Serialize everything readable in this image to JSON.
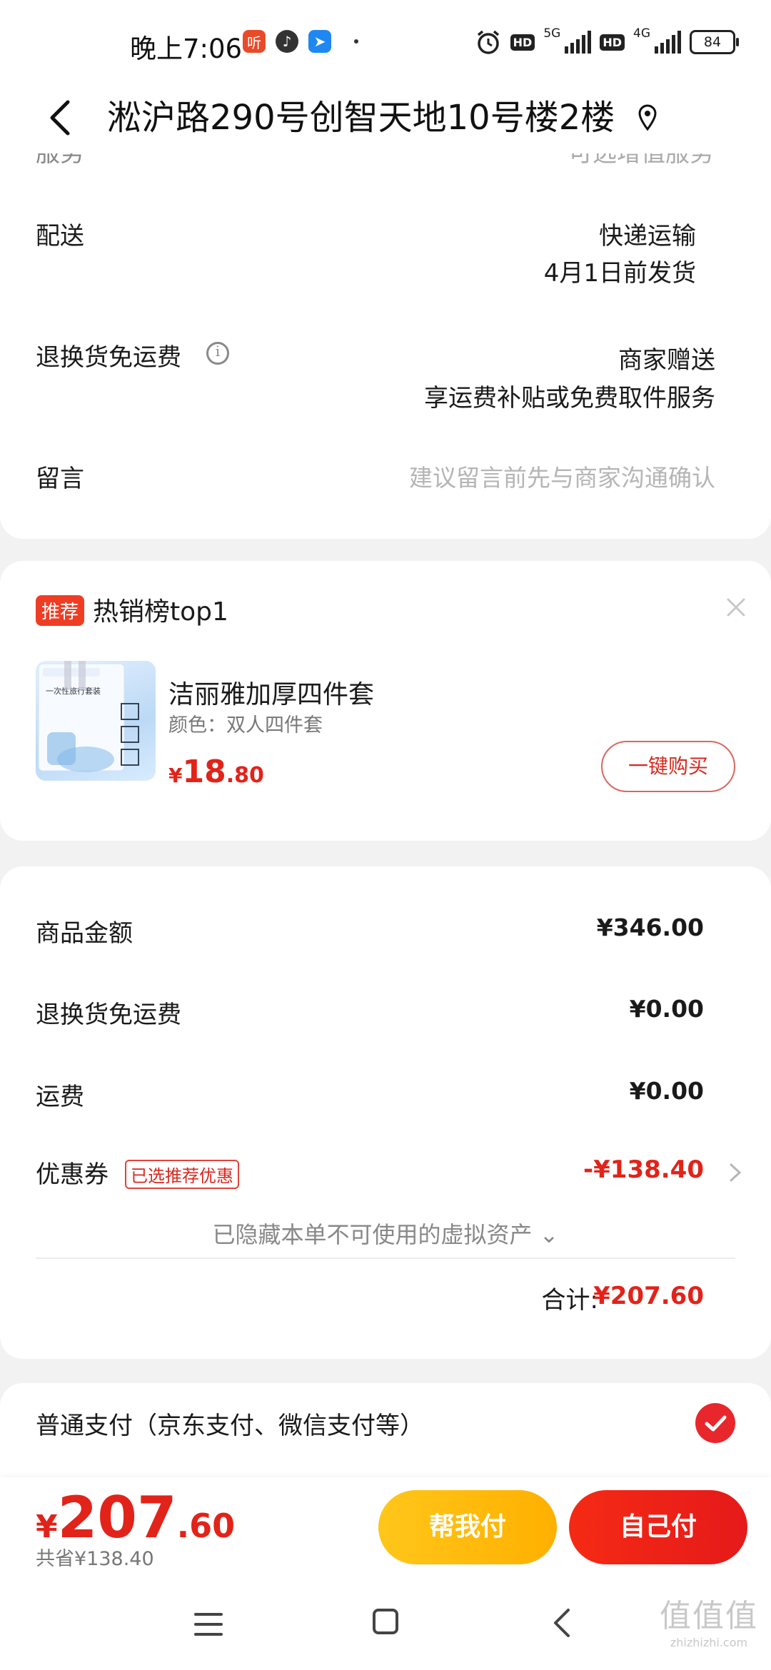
{
  "status_bar": {
    "time": "晚上7:06",
    "network_a": "5G",
    "network_b": "4G",
    "hd": "HD",
    "battery": "84",
    "app_icon_1": "听"
  },
  "header": {
    "address": "淞沪路290号创智天地10号楼2楼"
  },
  "order_info": {
    "cut_row_label": "服务",
    "cut_row_value": "可选增值服务",
    "delivery_label": "配送",
    "delivery_method": "快递运输",
    "delivery_time": "4月1日前发货",
    "return_label": "退换货免运费",
    "return_value_1": "商家赠送",
    "return_value_2": "享运费补贴或免费取件服务",
    "message_label": "留言",
    "message_placeholder": "建议留言前先与商家沟通确认"
  },
  "recommend": {
    "badge": "推荐",
    "title": "热销榜top1",
    "product_name": "洁丽雅加厚四件套",
    "product_spec": "颜色：双人四件套",
    "price_symbol": "¥",
    "price_int": "18",
    "price_dec": ".80",
    "buy_button": "一键购买",
    "image_text": "一次性旅行套装"
  },
  "summary": {
    "goods_amount_label": "商品金额",
    "goods_amount": "¥346.00",
    "return_fee_label": "退换货免运费",
    "return_fee": "¥0.00",
    "shipping_label": "运费",
    "shipping": "¥0.00",
    "coupon_label": "优惠券",
    "coupon_tag": "已选推荐优惠",
    "coupon_value": "-¥138.40",
    "hidden_note": "已隐藏本单不可使用的虚拟资产 ⌄",
    "total_label": "合计:",
    "total_value": "¥207.60"
  },
  "payment": {
    "method_label": "普通支付（京东支付、微信支付等）"
  },
  "bottom_bar": {
    "price_symbol": "¥",
    "price_int": "207",
    "price_dec": ".60",
    "saved": "共省¥138.40",
    "help_pay": "帮我付",
    "self_pay": "自己付"
  },
  "watermark": {
    "big": "值值值",
    "small": "zhizhizhi.com"
  },
  "colors": {
    "accent_red": "#e2231a",
    "help_pay_yellow": "#ffb000"
  }
}
